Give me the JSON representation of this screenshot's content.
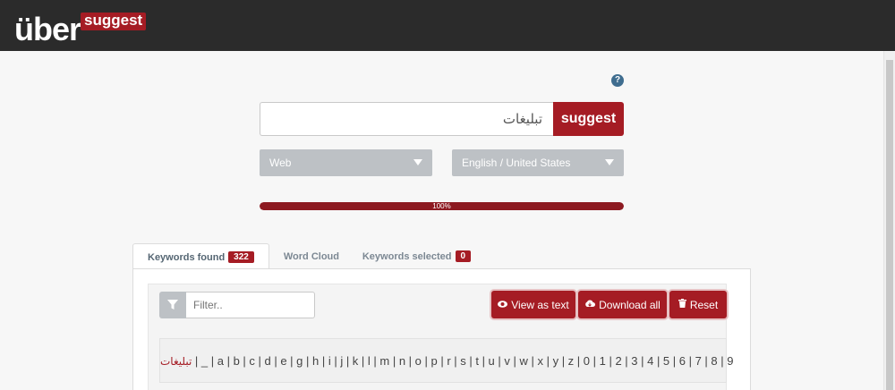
{
  "header": {
    "logo_main": "über",
    "logo_sub": "suggest"
  },
  "help": {
    "icon": "question-circle-icon",
    "label": "?"
  },
  "search": {
    "value": "تبليغات",
    "button_label": "suggest"
  },
  "selects": {
    "source": "Web",
    "language": "English / United States"
  },
  "progress": {
    "percent": 100,
    "label": "100%"
  },
  "tabs": [
    {
      "label": "Keywords found",
      "badge": "322"
    },
    {
      "label": "Word Cloud",
      "badge": ""
    },
    {
      "label": "Keywords selected",
      "badge": "0"
    }
  ],
  "filter": {
    "placeholder": "Filter..",
    "icon": "funnel-icon"
  },
  "actions": {
    "view_as_text": "View as text",
    "download_all": "Download all",
    "reset": "Reset"
  },
  "alphabet": {
    "term": "تبليغات",
    "rest": "| _ | a | b | c | d | e | g | h | i | j | k | l | m | n | o | p | r | s | t | u | v | w | x | y | z | 0 | 1 | 2 | 3 | 4 | 5 | 6 | 7 | 8 | 9"
  },
  "colors": {
    "brand": "#a51c24",
    "topbar": "#2b2b2b",
    "select": "#bdc1c5"
  }
}
